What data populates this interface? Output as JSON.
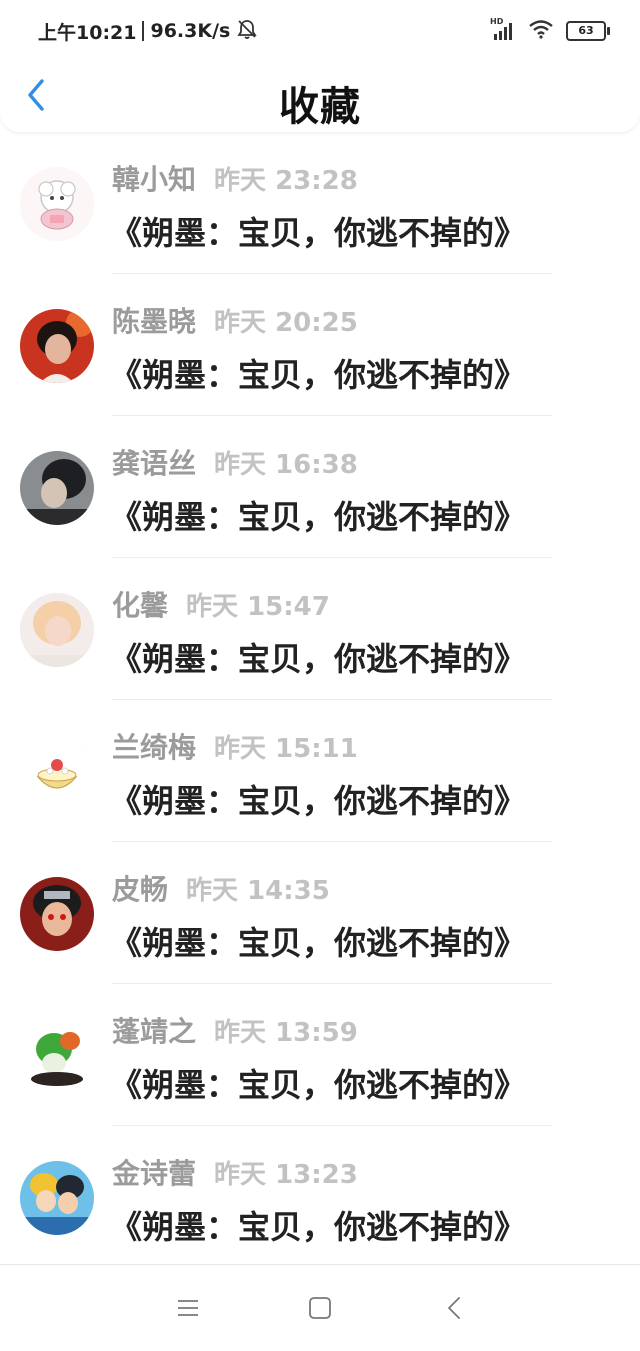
{
  "status_bar": {
    "time": "上午10:21",
    "speed": "96.3K/s",
    "hd_label": "HD",
    "battery": "63",
    "icons": [
      "mute-bell-icon",
      "signal-icon",
      "wifi-icon",
      "battery-icon"
    ]
  },
  "header": {
    "title": "收藏",
    "back_icon": "chevron-left-icon",
    "accent_color": "#2f8fe6"
  },
  "items": [
    {
      "name": "韓小知",
      "time": "昨天 23:28",
      "title": "《朔墨：宝贝，你逃不掉的》",
      "avatar": "cartoon-lamb-avatar"
    },
    {
      "name": "陈墨晓",
      "time": "昨天 20:25",
      "title": "《朔墨：宝贝，你逃不掉的》",
      "avatar": "photo-avatar"
    },
    {
      "name": "龚语丝",
      "time": "昨天 16:38",
      "title": "《朔墨：宝贝，你逃不掉的》",
      "avatar": "photo-avatar"
    },
    {
      "name": "化馨",
      "time": "昨天 15:47",
      "title": "《朔墨：宝贝，你逃不掉的》",
      "avatar": "photo-avatar"
    },
    {
      "name": "兰绮梅",
      "time": "昨天 15:11",
      "title": "《朔墨：宝贝，你逃不掉的》",
      "avatar": "cartoon-dessert-avatar"
    },
    {
      "name": "皮畅",
      "time": "昨天 14:35",
      "title": "《朔墨：宝贝，你逃不掉的》",
      "avatar": "anime-avatar"
    },
    {
      "name": "蓬靖之",
      "time": "昨天 13:59",
      "title": "《朔墨：宝贝，你逃不掉的》",
      "avatar": "jade-cabbage-avatar"
    },
    {
      "name": "金诗蕾",
      "time": "昨天 13:23",
      "title": "《朔墨：宝贝，你逃不掉的》",
      "avatar": "anime-group-avatar"
    }
  ],
  "nav_bar": {
    "icons": [
      "menu-icon",
      "home-square-icon",
      "back-triangle-icon"
    ]
  }
}
